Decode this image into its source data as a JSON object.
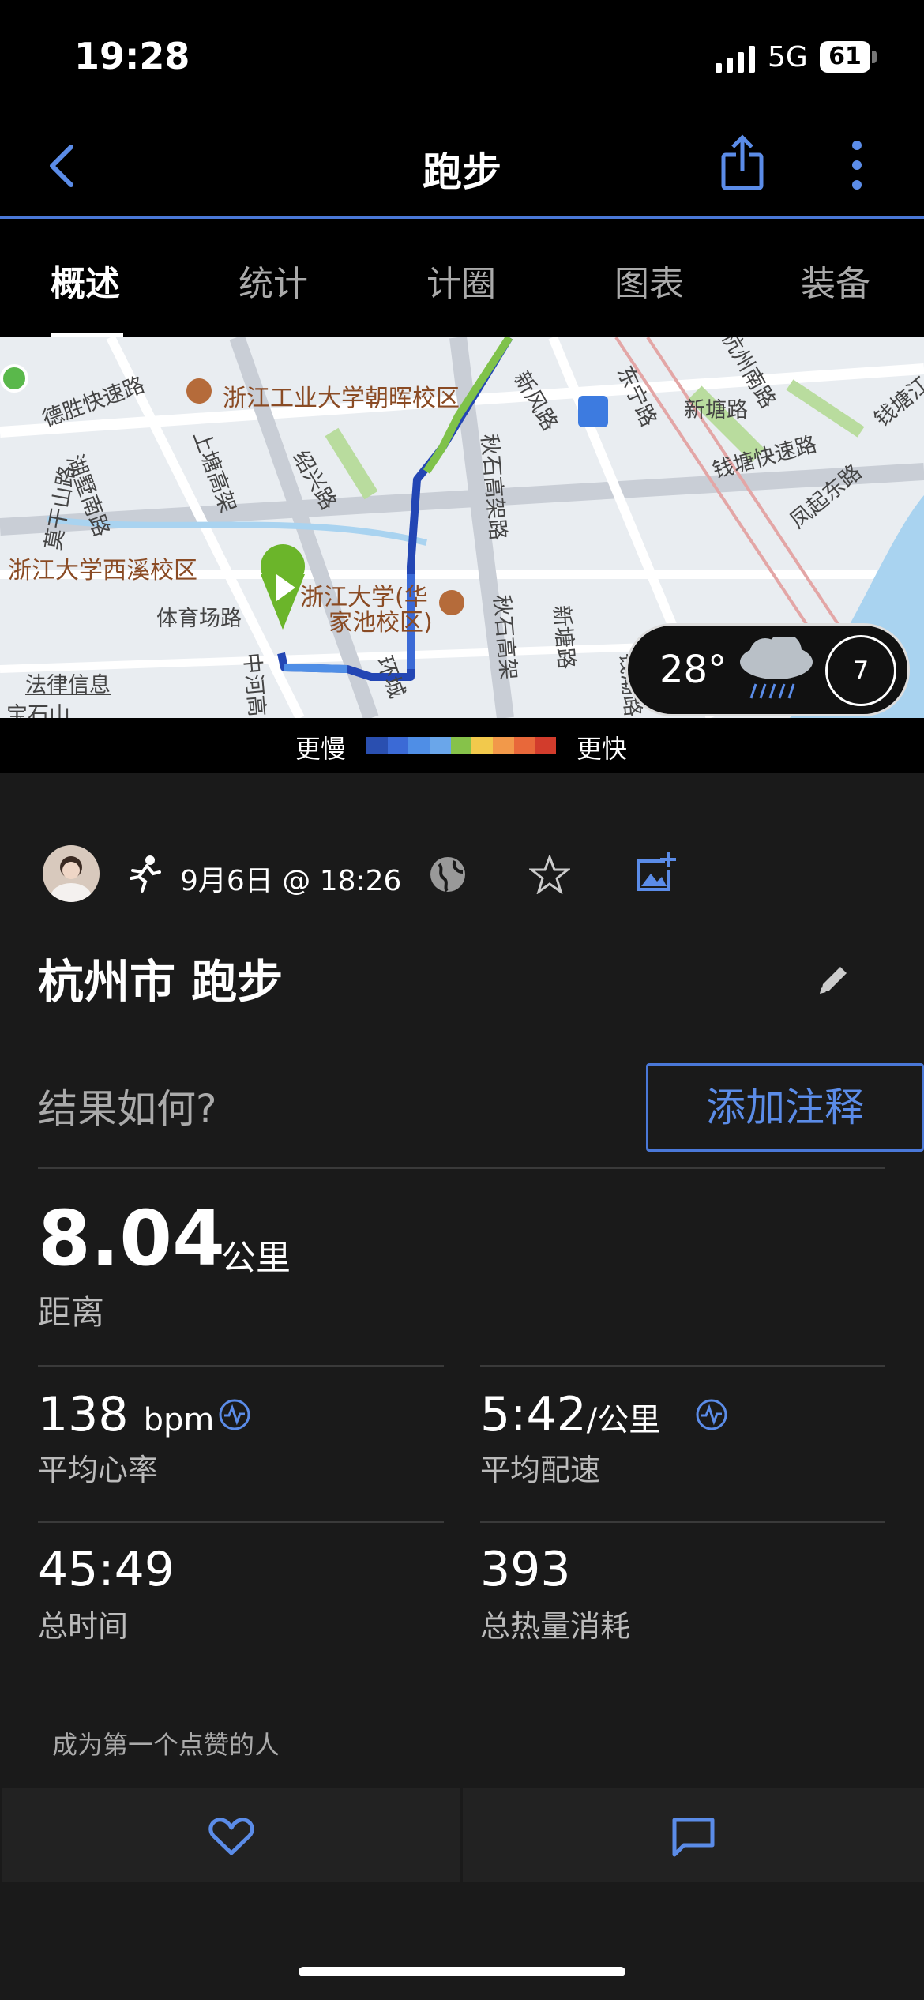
{
  "status": {
    "time": "19:28",
    "network": "5G",
    "battery": "61"
  },
  "nav": {
    "title": "跑步"
  },
  "tabs": [
    {
      "label": "概述"
    },
    {
      "label": "统计"
    },
    {
      "label": "计圈"
    },
    {
      "label": "图表"
    },
    {
      "label": "装备"
    }
  ],
  "map": {
    "labels": {
      "school1": "浙江工业大学朝晖校区",
      "school2": "浙江大学西溪校区",
      "school3a": "浙江大学(华",
      "school3b": "家池校区)",
      "r1": "德胜快速路",
      "r2": "上塘高架",
      "r3": "绍兴路",
      "r4": "湖墅南路",
      "r5": "莫干山路",
      "r6": "体育场路",
      "r7": "中河高",
      "r8": "环城",
      "r9": "秋石高架路",
      "r10": "秋石高架",
      "r11": "新塘路",
      "r12": "新风路",
      "r13": "东宁路",
      "r14": "新塘路",
      "r15": "钱塘快速路",
      "r16": "凤起东路",
      "r17": "钱塘江",
      "r18": "钱潮路",
      "r19": "杭州南路",
      "r20": "钱塘快",
      "legal": "法律信息",
      "last": "宝石山"
    },
    "weather": {
      "temp": "28°",
      "wind": "7"
    }
  },
  "legend": {
    "slow": "更慢",
    "fast": "更快",
    "colors": [
      "#2a4fb0",
      "#3b6ad6",
      "#4f8ee6",
      "#6aa6ea",
      "#86c24a",
      "#f2c94c",
      "#f2994a",
      "#e8683a",
      "#d23c2c"
    ]
  },
  "activity": {
    "date": "9月6日 @ 18:26",
    "title": "杭州市 跑步",
    "note_prompt": "结果如何?",
    "note_button": "添加注释"
  },
  "stats": {
    "distance": {
      "value": "8.04",
      "unit": "公里",
      "label": "距离"
    },
    "heart_rate": {
      "value": "138",
      "unit": "bpm",
      "label": "平均心率"
    },
    "pace": {
      "value": "5:42",
      "unit": "/公里",
      "label": "平均配速"
    },
    "time": {
      "value": "45:49",
      "label": "总时间"
    },
    "calories": {
      "value": "393",
      "label": "总热量消耗"
    }
  },
  "social": {
    "likes_text": "成为第一个点赞的人"
  },
  "colors": {
    "accent": "#4a78d8",
    "background": "#1a1a1a"
  }
}
